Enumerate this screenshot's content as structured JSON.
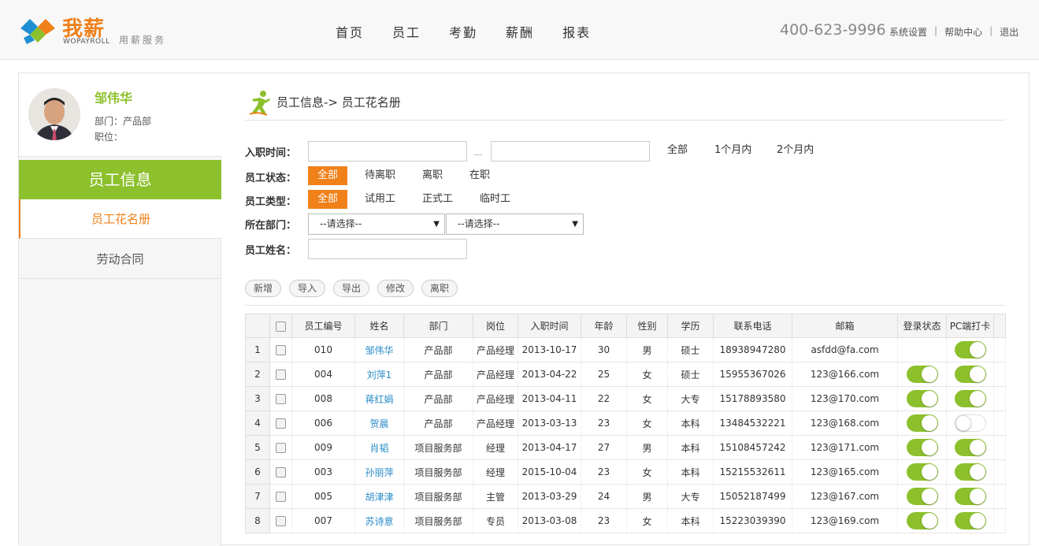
{
  "header": {
    "logo_cn": "我薪",
    "logo_en": "WOPAYROLL",
    "slogan": "用薪服务",
    "nav": [
      "首页",
      "员工",
      "考勤",
      "薪酬",
      "报表"
    ],
    "phone": "400-623-9996",
    "links": [
      "系统设置",
      "帮助中心",
      "退出"
    ]
  },
  "profile": {
    "name": "邹伟华",
    "dept": "部门：产品部",
    "position": "职位："
  },
  "sidebar": {
    "title": "员工信息",
    "items": [
      "员工花名册",
      "劳动合同"
    ]
  },
  "breadcrumb": "员工信息-> 员工花名册",
  "filters": {
    "hire_date_label": "入职时间：",
    "hire_date_dash": "—",
    "hire_opts": [
      "全部",
      "1个月内",
      "2个月内"
    ],
    "status_label": "员工状态：",
    "status_opts": [
      "全部",
      "待离职",
      "离职",
      "在职"
    ],
    "type_label": "员工类型：",
    "type_opts": [
      "全部",
      "试用工",
      "正式工",
      "临时工"
    ],
    "dept_label": "所在部门：",
    "dept_select_1": "--请选择--",
    "dept_select_2": "--请选择--",
    "name_label": "员工姓名："
  },
  "buttons": [
    "新增",
    "导入",
    "导出",
    "修改",
    "离职"
  ],
  "table": {
    "columns": [
      "员工编号",
      "姓名",
      "部门",
      "岗位",
      "入职时间",
      "年龄",
      "性别",
      "学历",
      "联系电话",
      "邮箱",
      "登录状态",
      "PC端打卡"
    ],
    "rows": [
      {
        "n": "1",
        "id": "010",
        "name": "邹伟华",
        "dept": "产品部",
        "post": "产品经理",
        "date": "2013-10-17",
        "age": "30",
        "sex": "男",
        "edu": "硕士",
        "phone": "18938947280",
        "email": "asfdd@fa.com",
        "login": null,
        "pc": true
      },
      {
        "n": "2",
        "id": "004",
        "name": "刘萍1",
        "dept": "产品部",
        "post": "产品经理",
        "date": "2013-04-22",
        "age": "25",
        "sex": "女",
        "edu": "硕士",
        "phone": "15955367026",
        "email": "123@166.com",
        "login": true,
        "pc": true
      },
      {
        "n": "3",
        "id": "008",
        "name": "蒋红娟",
        "dept": "产品部",
        "post": "产品经理",
        "date": "2013-04-11",
        "age": "22",
        "sex": "女",
        "edu": "大专",
        "phone": "15178893580",
        "email": "123@170.com",
        "login": true,
        "pc": true
      },
      {
        "n": "4",
        "id": "006",
        "name": "贺晨",
        "dept": "产品部",
        "post": "产品经理",
        "date": "2013-03-13",
        "age": "23",
        "sex": "女",
        "edu": "本科",
        "phone": "13484532221",
        "email": "123@168.com",
        "login": true,
        "pc": false
      },
      {
        "n": "5",
        "id": "009",
        "name": "肖韬",
        "dept": "项目服务部",
        "post": "经理",
        "date": "2013-04-17",
        "age": "27",
        "sex": "男",
        "edu": "本科",
        "phone": "15108457242",
        "email": "123@171.com",
        "login": true,
        "pc": true
      },
      {
        "n": "6",
        "id": "003",
        "name": "孙丽萍",
        "dept": "项目服务部",
        "post": "经理",
        "date": "2015-10-04",
        "age": "23",
        "sex": "女",
        "edu": "本科",
        "phone": "15215532611",
        "email": "123@165.com",
        "login": true,
        "pc": true
      },
      {
        "n": "7",
        "id": "005",
        "name": "胡津津",
        "dept": "项目服务部",
        "post": "主管",
        "date": "2013-03-29",
        "age": "24",
        "sex": "男",
        "edu": "大专",
        "phone": "15052187499",
        "email": "123@167.com",
        "login": true,
        "pc": true
      },
      {
        "n": "8",
        "id": "007",
        "name": "苏诗意",
        "dept": "项目服务部",
        "post": "专员",
        "date": "2013-03-08",
        "age": "23",
        "sex": "女",
        "edu": "本科",
        "phone": "15223039390",
        "email": "123@169.com",
        "login": true,
        "pc": true
      }
    ]
  },
  "colors": {
    "accent_green": "#8cc02c",
    "accent_orange": "#f0801a",
    "link_blue": "#2a8bc8"
  }
}
